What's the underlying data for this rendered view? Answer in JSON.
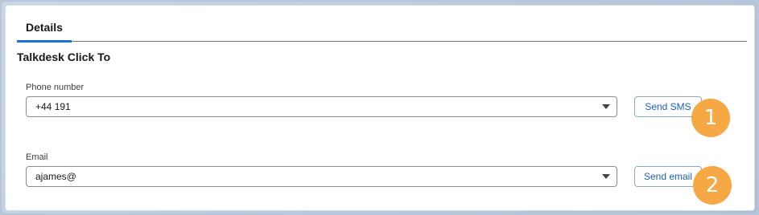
{
  "tabs": [
    {
      "label": "Details",
      "active": true
    }
  ],
  "section": {
    "title": "Talkdesk Click To"
  },
  "phone": {
    "label": "Phone number",
    "value": "+44 191",
    "button_label": "Send SMS"
  },
  "email": {
    "label": "Email",
    "value": "ajames@",
    "button_label": "Send email"
  },
  "badges": [
    "1",
    "2"
  ],
  "colors": {
    "accent": "#1b6fd8",
    "button_text": "#1b5fb5",
    "badge": "#f5a843"
  }
}
